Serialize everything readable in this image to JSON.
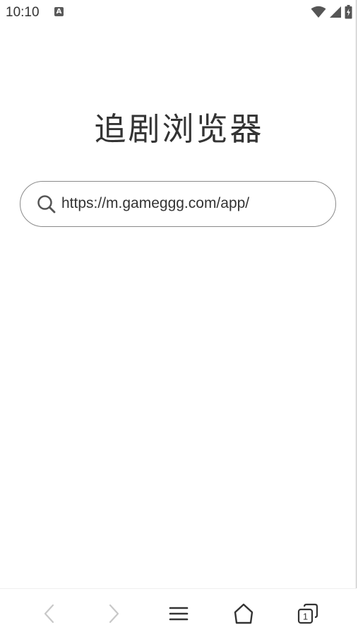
{
  "status_bar": {
    "time": "10:10",
    "notification_icon_letter": "A"
  },
  "app": {
    "title": "追剧浏览器"
  },
  "search": {
    "value": "https://m.gameggg.com/app/"
  },
  "bottom_nav": {
    "back_icon": "chevron-left-icon",
    "forward_icon": "chevron-right-icon",
    "menu_icon": "hamburger-menu-icon",
    "home_icon": "home-icon",
    "tabs_icon": "tabs-icon",
    "tab_count": "1"
  },
  "colors": {
    "background": "#ffffff",
    "text": "#333333",
    "disabled": "#c8c8c8",
    "border": "#8a8a8a"
  }
}
